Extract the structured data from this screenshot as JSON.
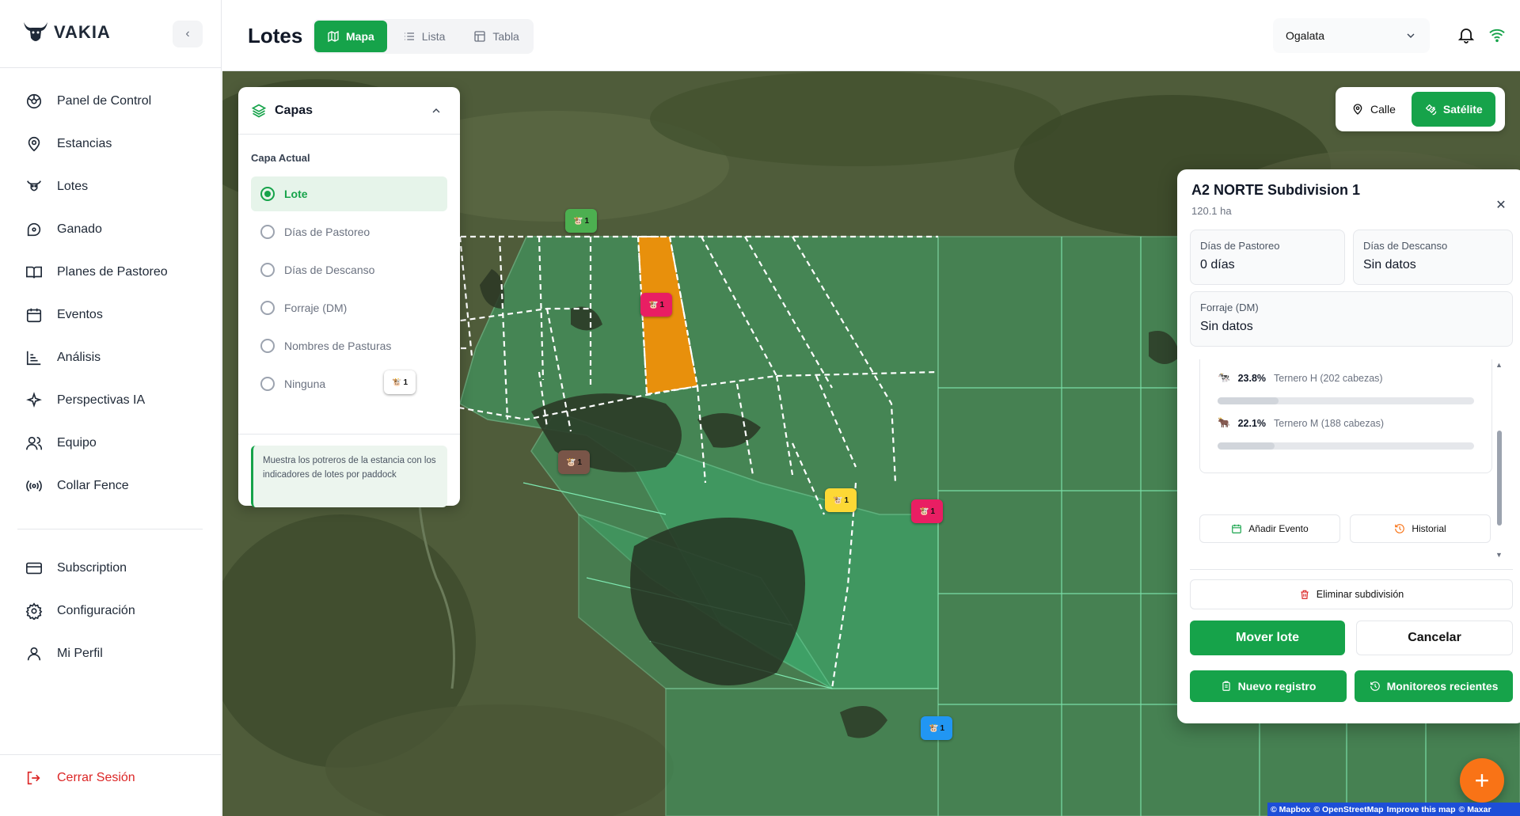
{
  "app": {
    "brand": "VAKIA"
  },
  "sidebar": {
    "items": [
      {
        "label": "Panel de Control",
        "icon": "dashboard-icon"
      },
      {
        "label": "Estancias",
        "icon": "map-pin-icon"
      },
      {
        "label": "Lotes",
        "icon": "cow-icon"
      },
      {
        "label": "Ganado",
        "icon": "tag-icon"
      },
      {
        "label": "Planes de Pastoreo",
        "icon": "book-icon"
      },
      {
        "label": "Eventos",
        "icon": "calendar-icon"
      },
      {
        "label": "Análisis",
        "icon": "chart-icon"
      },
      {
        "label": "Perspectivas IA",
        "icon": "sparkle-icon"
      },
      {
        "label": "Equipo",
        "icon": "users-icon"
      },
      {
        "label": "Collar Fence",
        "icon": "radio-icon"
      }
    ],
    "items2": [
      {
        "label": "Subscription",
        "icon": "credit-card-icon"
      },
      {
        "label": "Configuración",
        "icon": "gear-icon"
      },
      {
        "label": "Mi Perfil",
        "icon": "user-icon"
      }
    ],
    "logout": "Cerrar Sesión"
  },
  "header": {
    "title": "Lotes",
    "tabs": [
      {
        "label": "Mapa",
        "active": true
      },
      {
        "label": "Lista",
        "active": false
      },
      {
        "label": "Tabla",
        "active": false
      }
    ],
    "estancia": "Ogalata"
  },
  "layers": {
    "title": "Capas",
    "current_label": "Capa Actual",
    "options": [
      "Lote",
      "Días de Pastoreo",
      "Días de Descanso",
      "Forraje (DM)",
      "Nombres de Pasturas",
      "Ninguna"
    ],
    "selected": "Lote",
    "info": "Muestra los potreros de la estancia con los indicadores de lotes por paddock"
  },
  "map_style": {
    "street": "Calle",
    "satellite": "Satélite",
    "active": "Satélite"
  },
  "markers": [
    {
      "count": "1",
      "color": "#4caf50"
    },
    {
      "count": "1",
      "color": "#e91e63"
    },
    {
      "count": "1",
      "color": "#ffffff"
    },
    {
      "count": "1",
      "color": "#795548"
    },
    {
      "count": "1",
      "color": "#fdd835"
    },
    {
      "count": "1",
      "color": "#e91e63"
    },
    {
      "count": "1",
      "color": "#2196f3"
    },
    {
      "count": "1",
      "color": "#7c3aed"
    }
  ],
  "detail": {
    "title": "A2 NORTE Subdivision 1",
    "area": "120.1 ha",
    "grazing_days_label": "Días de Pastoreo",
    "grazing_days": "0 días",
    "rest_days_label": "Días de Descanso",
    "rest_days": "Sin datos",
    "forage_label": "Forraje (DM)",
    "forage": "Sin datos",
    "herd": [
      {
        "pct": "23.8%",
        "label": "Ternero H (202 cabezas)",
        "fraction": 0.238
      },
      {
        "pct": "22.1%",
        "label": "Ternero M (188 cabezas)",
        "fraction": 0.221
      }
    ],
    "add_event": "Añadir Evento",
    "history": "Historial",
    "delete": "Eliminar subdivisión",
    "move": "Mover lote",
    "cancel": "Cancelar",
    "new_record": "Nuevo registro",
    "recent": "Monitoreos recientes"
  },
  "attribution": {
    "mapbox": "© Mapbox",
    "osm": "© OpenStreetMap",
    "improve": "Improve this map",
    "maxar": "© Maxar"
  },
  "colors": {
    "accent": "#16a34a",
    "danger": "#dc2626",
    "selected_paddock": "#e8900c",
    "fab": "#f97316"
  }
}
